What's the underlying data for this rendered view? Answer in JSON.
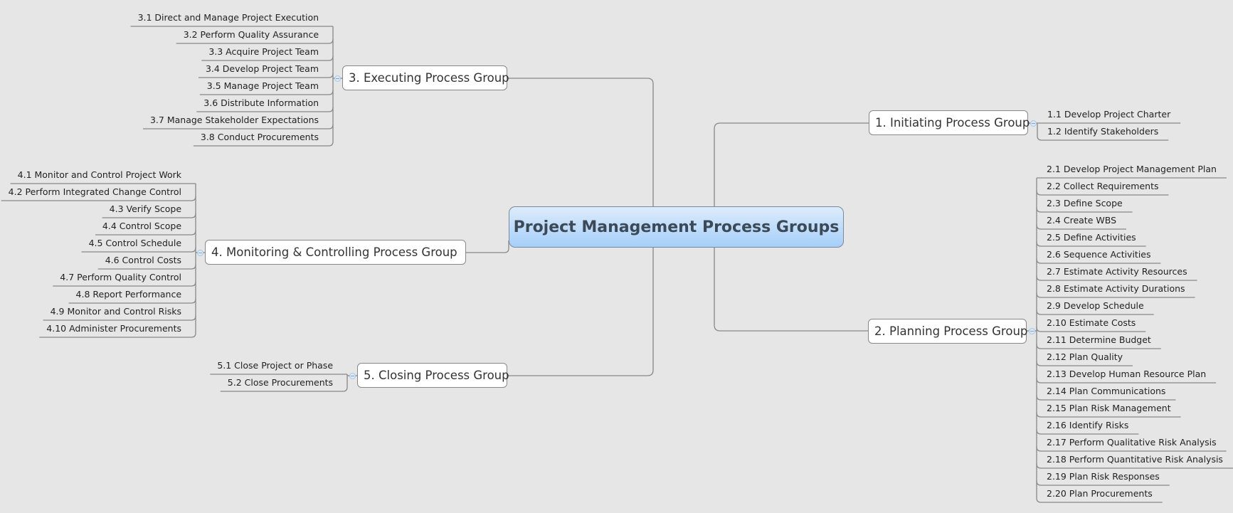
{
  "central": {
    "title": "Project Management Process Groups"
  },
  "colors": {
    "background": "#e6e6e6",
    "central_top": "#dcebfb",
    "central_bottom": "#a6cff9",
    "line": "#888888"
  },
  "groups": [
    {
      "id": "initiating",
      "title": "1. Initiating Process Group",
      "items": [
        "1.1  Develop Project Charter",
        "1.2  Identify Stakeholders"
      ]
    },
    {
      "id": "planning",
      "title": "2. Planning Process Group",
      "items": [
        "2.1  Develop Project Management Plan",
        "2.2  Collect Requirements",
        "2.3  Define Scope",
        "2.4  Create WBS",
        "2.5  Define Activities",
        "2.6  Sequence Activities",
        "2.7  Estimate Activity Resources",
        "2.8  Estimate Activity Durations",
        "2.9  Develop Schedule",
        "2.10  Estimate Costs",
        "2.11  Determine Budget",
        "2.12  Plan Quality",
        "2.13  Develop Human Resource Plan",
        "2.14  Plan Communications",
        "2.15  Plan Risk Management",
        "2.16  Identify Risks",
        "2.17  Perform Qualitative Risk Analysis",
        "2.18  Perform Quantitative Risk Analysis",
        "2.19  Plan Risk Responses",
        "2.20  Plan Procurements"
      ]
    },
    {
      "id": "executing",
      "title": "3. Executing Process Group",
      "items": [
        "3.1  Direct and Manage Project Execution",
        "3.2  Perform Quality Assurance",
        "3.3  Acquire Project Team",
        "3.4  Develop Project Team",
        "3.5  Manage Project Team",
        "3.6  Distribute Information",
        "3.7  Manage Stakeholder Expectations",
        "3.8  Conduct Procurements"
      ]
    },
    {
      "id": "monitoring",
      "title": "4. Monitoring  & Controlling  Process Group",
      "items": [
        "4.1  Monitor and Control Project Work",
        "4.2  Perform Integrated Change Control",
        "4.3  Verify Scope",
        "4.4  Control Scope",
        "4.5  Control Schedule",
        "4.6  Control Costs",
        "4.7  Perform Quality Control",
        "4.8  Report Performance",
        "4.9  Monitor and Control Risks",
        "4.10  Administer Procurements"
      ]
    },
    {
      "id": "closing",
      "title": "5. Closing Process Group",
      "items": [
        "5.1  Close Project or Phase",
        "5.2  Close Procurements"
      ]
    }
  ]
}
